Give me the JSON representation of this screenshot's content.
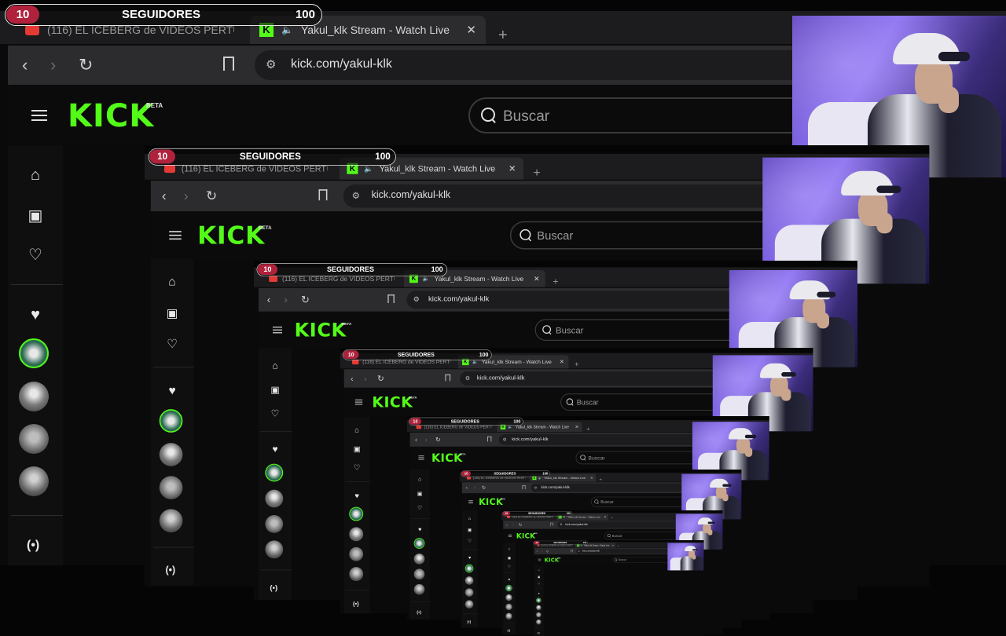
{
  "browser": {
    "tabs": [
      {
        "label": "(116) EL ICEBERG de VIDEOS PERTUR...",
        "active": false,
        "favicon": "youtube-favicon"
      },
      {
        "label": "Yakul_klk Stream - Watch Live",
        "active": true,
        "favicon": "kick-favicon"
      }
    ],
    "url": "kick.com/yakul-klk"
  },
  "kick": {
    "logo": "KICK",
    "beta": "BETA",
    "search_placeholder": "Buscar"
  },
  "overlay": {
    "current": "10",
    "label": "SEGUIDORES",
    "goal": "100"
  },
  "icons": {
    "menu": "hamburger-icon",
    "home": "home-icon",
    "browse": "browse-icon",
    "following": "heart-outline-icon",
    "following_section": "heart-icon",
    "live": "live-icon"
  }
}
